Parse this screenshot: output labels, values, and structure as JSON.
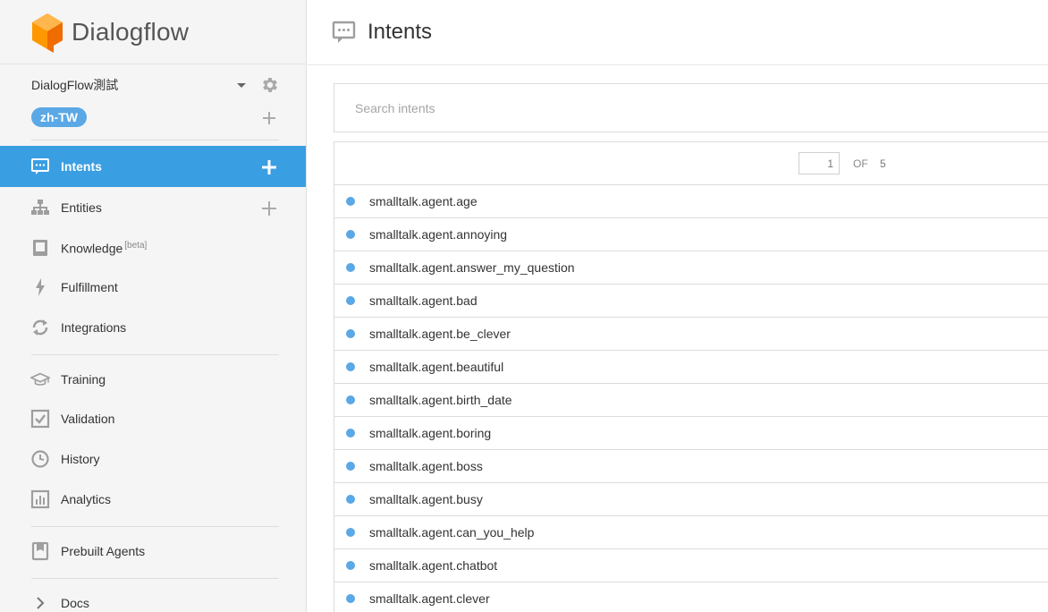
{
  "brand": {
    "name": "Dialogflow"
  },
  "agent": {
    "name": "DialogFlow測試",
    "language": "zh-TW"
  },
  "nav": {
    "intents": "Intents",
    "entities": "Entities",
    "knowledge": "Knowledge",
    "knowledge_badge": "[beta]",
    "fulfillment": "Fulfillment",
    "integrations": "Integrations",
    "training": "Training",
    "validation": "Validation",
    "history": "History",
    "analytics": "Analytics",
    "prebuilt": "Prebuilt Agents",
    "docs": "Docs"
  },
  "header": {
    "title": "Intents"
  },
  "search": {
    "placeholder": "Search intents",
    "value": ""
  },
  "pager": {
    "current": "1",
    "of_label": "OF",
    "total": "5"
  },
  "intents": [
    "smalltalk.agent.age",
    "smalltalk.agent.annoying",
    "smalltalk.agent.answer_my_question",
    "smalltalk.agent.bad",
    "smalltalk.agent.be_clever",
    "smalltalk.agent.beautiful",
    "smalltalk.agent.birth_date",
    "smalltalk.agent.boring",
    "smalltalk.agent.boss",
    "smalltalk.agent.busy",
    "smalltalk.agent.can_you_help",
    "smalltalk.agent.chatbot",
    "smalltalk.agent.clever"
  ],
  "colors": {
    "accent": "#3a9ee3",
    "badge": "#5aa8e6",
    "brand_orange": "#ef6c00"
  }
}
